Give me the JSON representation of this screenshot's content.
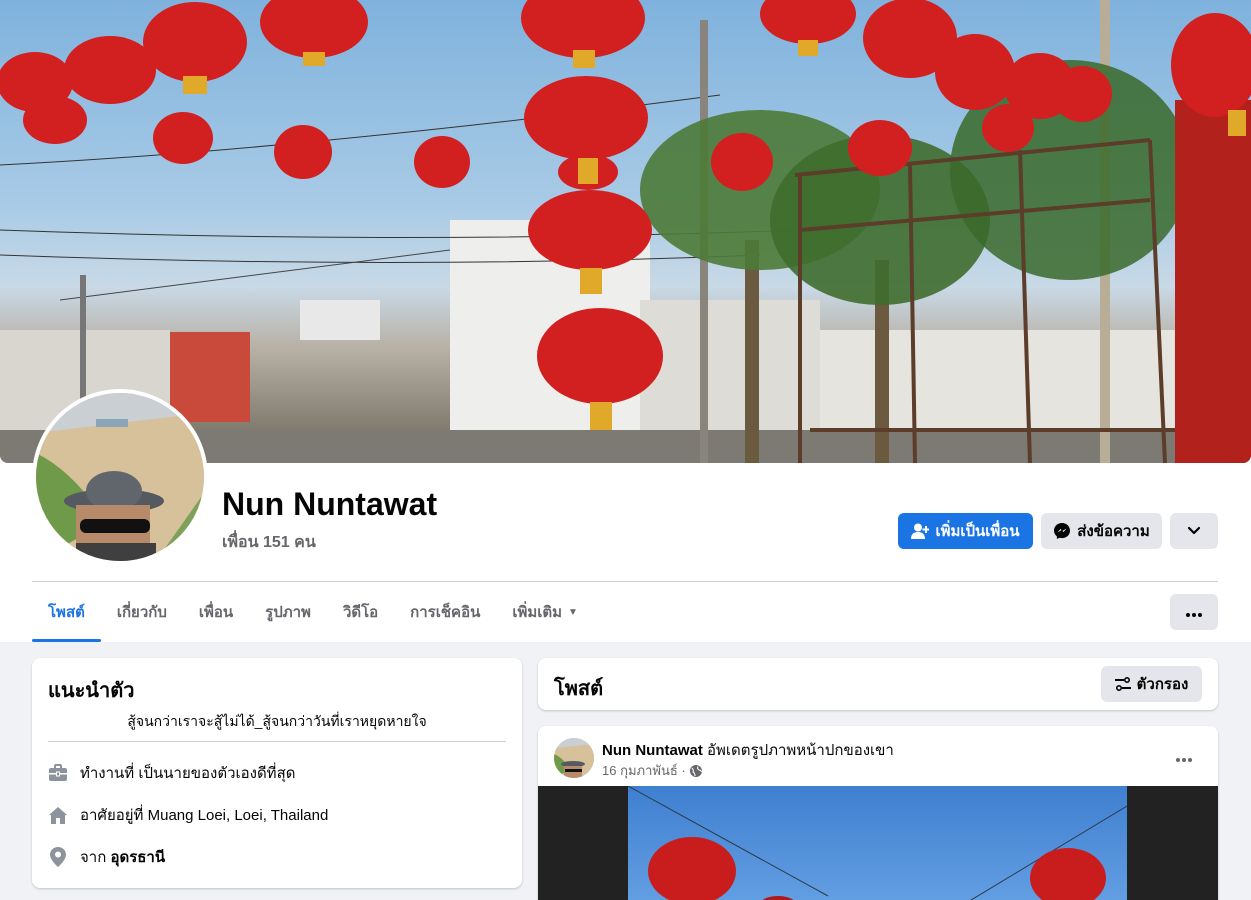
{
  "profile": {
    "name": "Nun Nuntawat",
    "friends_label": "เพื่อน 151 คน"
  },
  "actions": {
    "add_friend_label": "เพิ่มเป็นเพื่อน",
    "message_label": "ส่งข้อความ"
  },
  "tabs": [
    {
      "label": "โพสต์",
      "active": true
    },
    {
      "label": "เกี่ยวกับ"
    },
    {
      "label": "เพื่อน"
    },
    {
      "label": "รูปภาพ"
    },
    {
      "label": "วิดีโอ"
    },
    {
      "label": "การเช็คอิน"
    },
    {
      "label": "เพิ่มเติม"
    }
  ],
  "intro": {
    "title": "แนะนำตัว",
    "bio": "สู้จนกว่าเราจะสู้ไม่ได้_สู้จนกว่าวันที่เราหยุดหายใจ",
    "work": "ทำงานที่ เป็นนายของตัวเองดีที่สุด",
    "lives_prefix": "อาศัยอยู่ที่",
    "lives_place": "Muang Loei, Loei, Thailand",
    "from_prefix": "จาก",
    "from_place": "อุดรธานี"
  },
  "posts": {
    "title": "โพสต์",
    "filter_label": "ตัวกรอง"
  },
  "post": {
    "author": "Nun Nuntawat",
    "action_text": "อัพเดตรูปภาพหน้าปกของเขา",
    "date": "16 กุมภาพันธ์ ·"
  },
  "colors": {
    "accent": "#1b74e4",
    "background": "#f0f2f5",
    "lantern": "#d21f1f"
  }
}
